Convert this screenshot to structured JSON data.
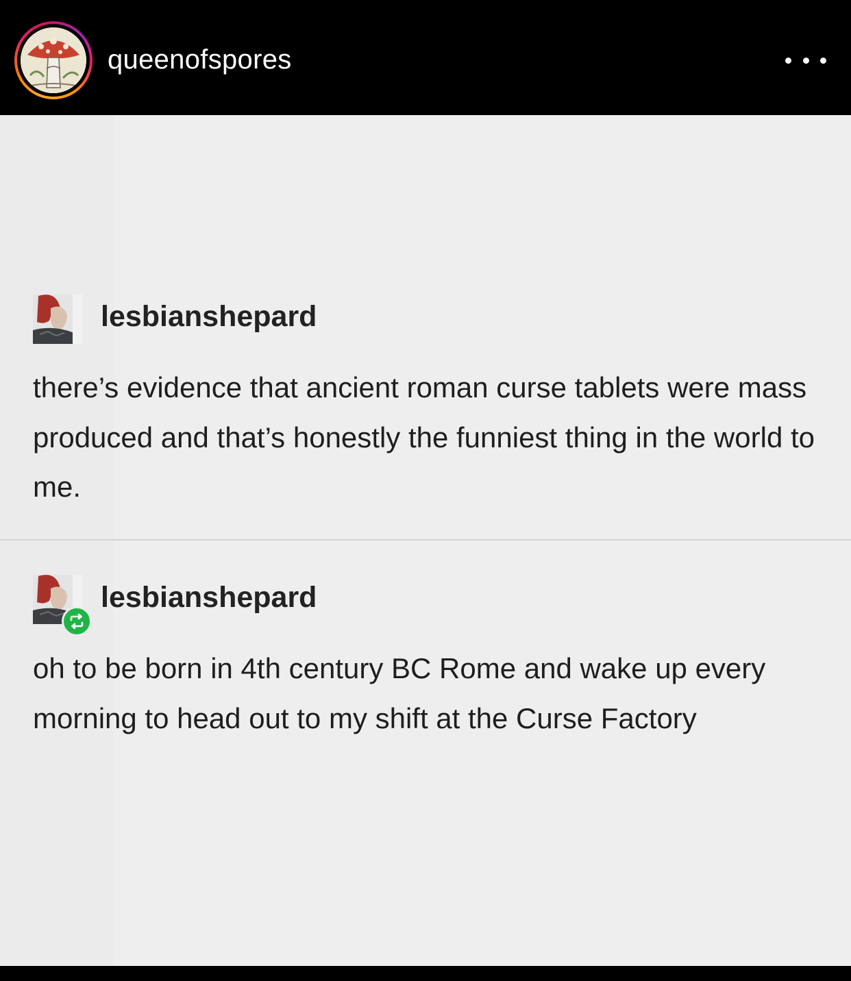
{
  "header": {
    "username": "queenofspores",
    "ring_colors": [
      "#f9a825",
      "#e91e63",
      "#9c27b0"
    ]
  },
  "post": {
    "entries": [
      {
        "username": "lesbianshepard",
        "text": "there’s evidence that ancient roman curse tablets were mass produced and that’s honestly the funniest thing in the world to me.",
        "reblog": false
      },
      {
        "username": "lesbianshepard",
        "text": "oh to be born in 4th century BC Rome and wake up every morning to head out to my shift at the Curse Factory",
        "reblog": true,
        "badge_icon": "reblog-icon",
        "badge_color": "#1fb546"
      }
    ]
  }
}
